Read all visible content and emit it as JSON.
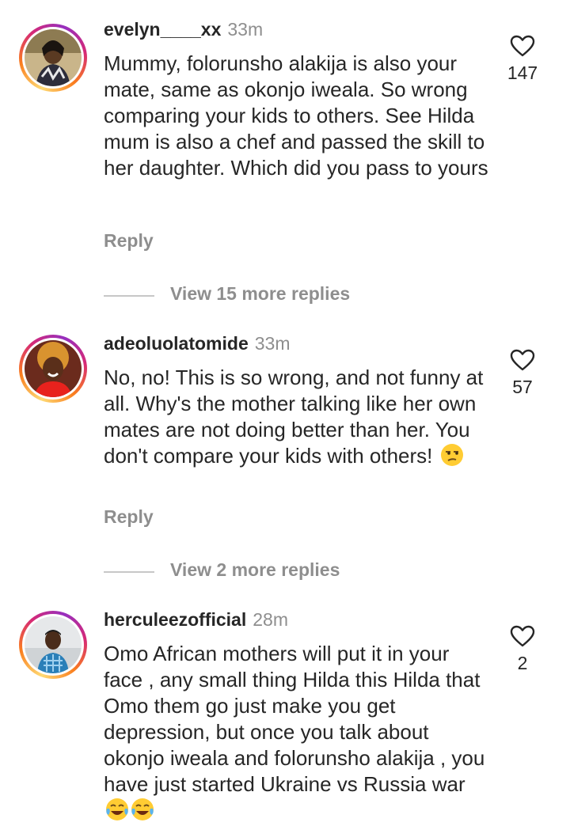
{
  "comments": [
    {
      "username": "evelyn____xx",
      "time": "33m",
      "text": "Mummy, folorunsho alakija is also your mate, same as okonjo iweala. So wrong comparing your kids to others. See Hilda mum is also a chef and passed the skill to her daughter. Which did you pass to yours",
      "likes": "147",
      "reply_label": "Reply",
      "view_more": "View 15 more replies"
    },
    {
      "username": "adeoluolatomide",
      "time": "33m",
      "text": "No, no! This is so wrong, and not funny at all. Why's the mother talking like her own mates are not doing better than her. You don't compare your kids with others!",
      "emoji": "😒",
      "likes": "57",
      "reply_label": "Reply",
      "view_more": "View 2 more replies"
    },
    {
      "username": "herculeezofficial",
      "time": "28m",
      "text": "Omo African mothers will put it in your face , any small thing Hilda this Hilda that Omo them go just make you get depression, but once you talk about okonjo iweala and folorunsho alakija , you have just started Ukraine vs Russia war",
      "emoji": "😂😂",
      "likes": "2"
    }
  ],
  "colors": {
    "text": "#262626",
    "muted": "#8e8e8e",
    "divider": "#c7c7c7",
    "story_ring": [
      "#feda75",
      "#fa7e1e",
      "#d62976",
      "#962fbf"
    ]
  },
  "icons": {
    "like": "heart-outline-icon",
    "emoji_unamused": "unamused-face-icon",
    "emoji_laughing": "tears-of-joy-icon"
  }
}
